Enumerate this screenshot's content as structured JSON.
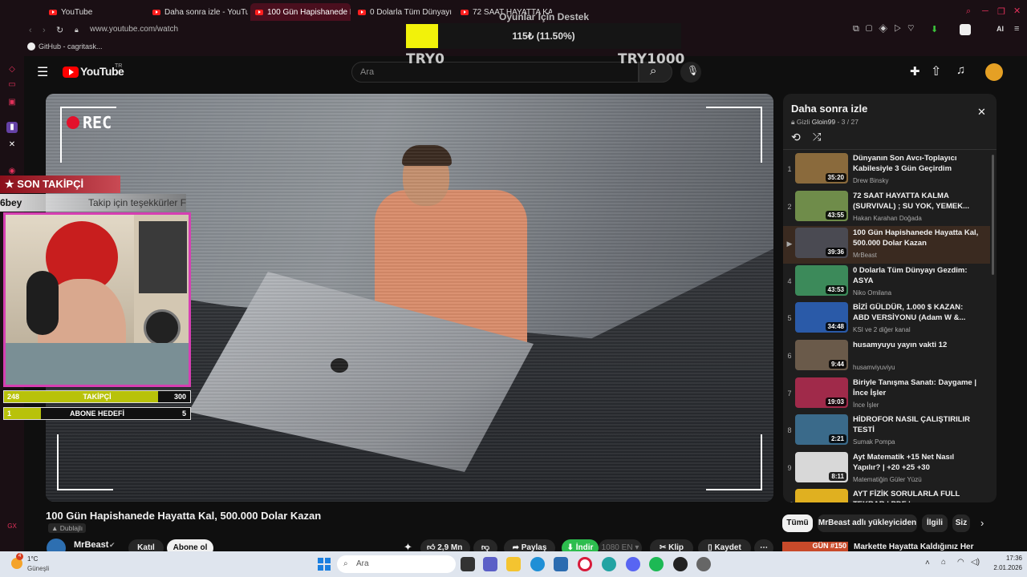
{
  "browser": {
    "tabs": [
      {
        "label": "YouTube",
        "active": false
      },
      {
        "label": "Daha sonra izle - YouTube",
        "active": false
      },
      {
        "label": "100 Gün Hapishanede Hay",
        "active": true
      },
      {
        "label": "0 Dolarla Tüm Dünyayı Ge",
        "active": false
      },
      {
        "label": "72 SAAT HAYATTA KALMA",
        "active": false
      }
    ],
    "url": "www.youtube.com/watch",
    "bookmark": "GitHub - cagritask...",
    "ai_label": "AI"
  },
  "donation": {
    "title": "Oyunlar İçin Destek",
    "amount_text": "115₺ (11.50%)",
    "progress": 0.115,
    "min_label": "TRY0",
    "max_label": "TRY1000",
    "fill_color": "#f2f20a"
  },
  "youtube": {
    "logo": "YouTube",
    "region": "TR",
    "search_placeholder": "Ara"
  },
  "video": {
    "rec_label": "REC",
    "title": "100 Gün Hapishanede Hayatta Kal, 500.000 Dolar Kazan",
    "dub_badge": "Dublajlı",
    "channel": "MrBeast",
    "join_label": "Katıl",
    "subscribe_label": "Abone ol",
    "like_count": "2,9 Mn",
    "share_label": "Paylaş",
    "download_label": "İndir",
    "quality": "1080",
    "lang": "EN",
    "clip_label": "Klip",
    "save_label": "Kaydet"
  },
  "stream_overlay": {
    "son_takipci_label": "SON TAKİPÇİ",
    "last_follower": "6bey",
    "thanks_text": "Takip için teşekkürler Fre",
    "follower_goal": {
      "current": "248",
      "label": "TAKİPÇİ",
      "target": "300",
      "progress": 0.827
    },
    "sub_goal": {
      "current": "1",
      "label": "ABONE HEDEFİ",
      "target": "5",
      "progress": 0.2
    }
  },
  "playlist": {
    "title": "Daha sonra izle",
    "privacy": "Gizli",
    "owner": "Gloin99",
    "position": "3 / 27",
    "items": [
      {
        "num": "1",
        "title": "Dünyanın Son Avcı-Toplayıcı Kabilesiyle 3 Gün Geçirdim",
        "channel": "Drew Binsky",
        "duration": "35:20",
        "color": "#8a6a3c"
      },
      {
        "num": "2",
        "title": "72 SAAT HAYATTA KALMA (SURVIVAL) ; SU YOK, YEMEK...",
        "channel": "Hakan Karahan Doğada",
        "duration": "43:55",
        "color": "#6f8c4a"
      },
      {
        "num": "▶",
        "title": "100 Gün Hapishanede Hayatta Kal, 500.000 Dolar Kazan",
        "channel": "MrBeast",
        "duration": "39:36",
        "color": "#4a4a52"
      },
      {
        "num": "4",
        "title": "0 Dolarla Tüm Dünyayı Gezdim: ASYA",
        "channel": "Niko Omilana",
        "duration": "43:53",
        "color": "#3c8a5a"
      },
      {
        "num": "5",
        "title": "BİZİ GÜLDÜR, 1.000 $ KAZAN: ABD VERSİYONU (Adam W &...",
        "channel": "KSI ve 2 diğer kanal",
        "duration": "34:48",
        "color": "#2a5aa8"
      },
      {
        "num": "6",
        "title": "husamyuyu yayın vakti 12",
        "channel": "husamviyuviyu",
        "duration": "9:44",
        "color": "#6a5a4a"
      },
      {
        "num": "7",
        "title": "Biriyle Tanışma Sanatı: Daygame | İnce İşler",
        "channel": "İnce İşler",
        "duration": "19:03",
        "color": "#a02a4a"
      },
      {
        "num": "8",
        "title": "HİDROFOR NASIL ÇALIŞTIRILIR TESTİ",
        "channel": "Sumak Pompa",
        "duration": "2:21",
        "color": "#3a6a8a"
      },
      {
        "num": "9",
        "title": "Ayt Matematik +15 Net Nasıl Yapılır? | +20 +25 +30",
        "channel": "Matematiğin Güler Yüzü",
        "duration": "8:11",
        "color": "#d8d8d8"
      },
      {
        "num": "10",
        "title": "AYT FİZİK SORULARLA FULL TEKRAR | PDF |",
        "channel": "",
        "duration": "",
        "color": "#e0b020"
      }
    ]
  },
  "chips": {
    "all": "Tümü",
    "uploader": "MrBeast adlı yükleyiciden",
    "related": "İlgili",
    "next": "Siz"
  },
  "recommendation": {
    "thumb_text": "GÜN #150",
    "title": "Markette Hayatta Kaldığınız Her"
  },
  "taskbar": {
    "weather_temp": "1°C",
    "weather_desc": "Güneşli",
    "weather_badge": "4",
    "search_placeholder": "Ara",
    "time": "17:36",
    "date": "2.01.2026"
  }
}
